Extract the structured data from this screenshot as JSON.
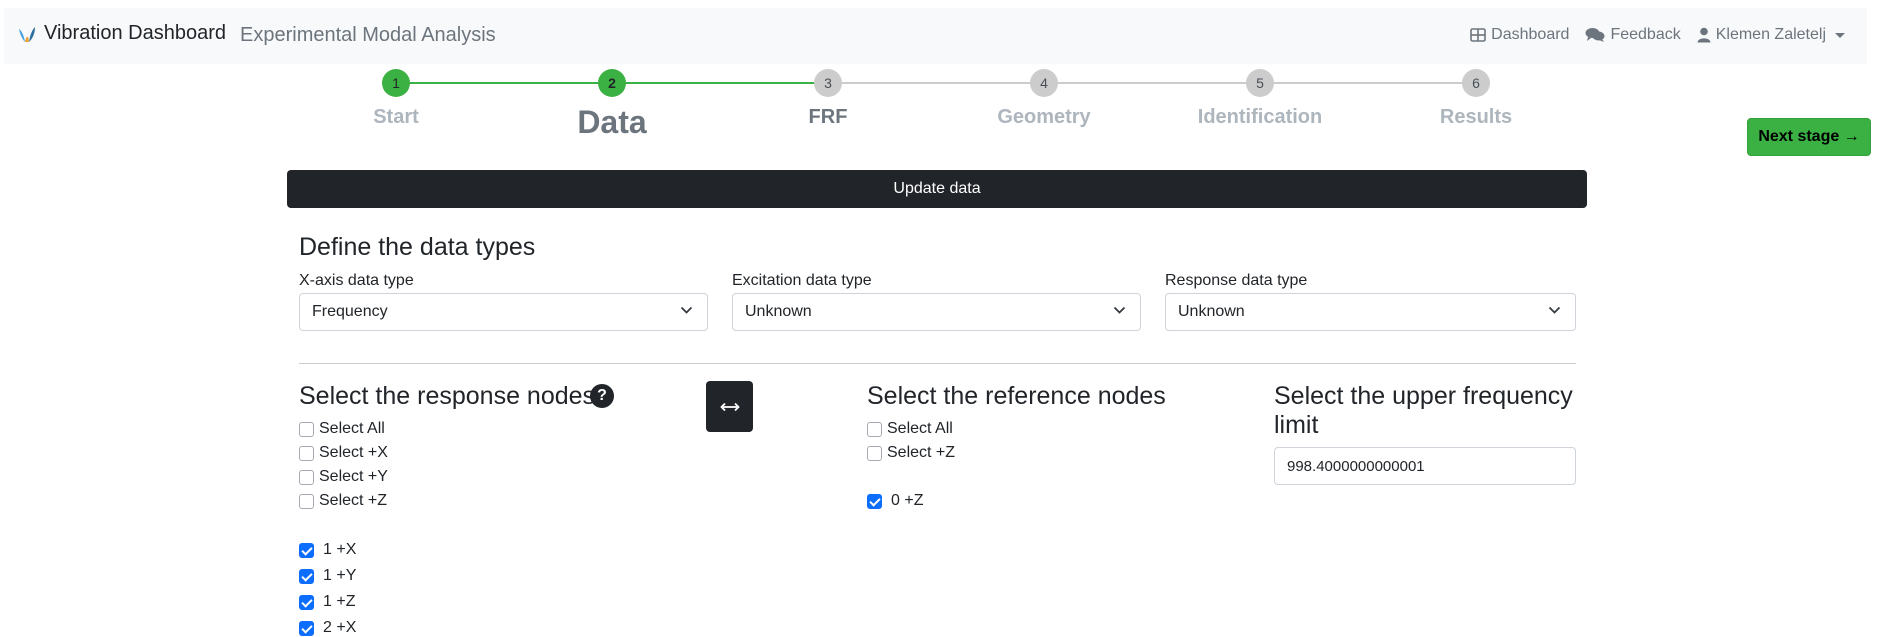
{
  "navbar": {
    "brand_title": "Vibration Dashboard",
    "brand_subtitle": "Experimental Modal Analysis",
    "links": {
      "dashboard": "Dashboard",
      "feedback": "Feedback",
      "user": "Klemen Zaletelj"
    },
    "icons": [
      "grid-icon",
      "comments-icon",
      "user-icon",
      "caret-down-icon"
    ]
  },
  "stepper": {
    "steps": [
      {
        "number": "1",
        "label": "Start",
        "state": "done"
      },
      {
        "number": "2",
        "label": "Data",
        "state": "active"
      },
      {
        "number": "3",
        "label": "FRF",
        "state": "next"
      },
      {
        "number": "4",
        "label": "Geometry",
        "state": "todo"
      },
      {
        "number": "5",
        "label": "Identification",
        "state": "todo"
      },
      {
        "number": "6",
        "label": "Results",
        "state": "todo"
      }
    ],
    "colors": {
      "done": "#3bb143",
      "todo": "#cccccc"
    }
  },
  "next_button": "Next stage →",
  "update_button": "Update data",
  "data_types": {
    "title": "Define the data types",
    "x_axis": {
      "label": "X-axis data type",
      "value": "Frequency"
    },
    "excitation": {
      "label": "Excitation data type",
      "value": "Unknown"
    },
    "response": {
      "label": "Response data type",
      "value": "Unknown"
    }
  },
  "response_nodes": {
    "title": "Select the response nodes",
    "help": "?",
    "select_options": [
      "Select All",
      "Select +X",
      "Select +Y",
      "Select +Z"
    ],
    "nodes": [
      "1 +X",
      "1 +Y",
      "1 +Z",
      "2 +X"
    ]
  },
  "reference_nodes": {
    "title": "Select the reference nodes",
    "select_options": [
      "Select All",
      "Select +Z"
    ],
    "nodes": [
      "0 +Z"
    ]
  },
  "frequency": {
    "title_line1": "Select the upper frequency",
    "title_line2": "limit",
    "value": "998.4000000000001"
  },
  "accent_color": "#0d6efd"
}
